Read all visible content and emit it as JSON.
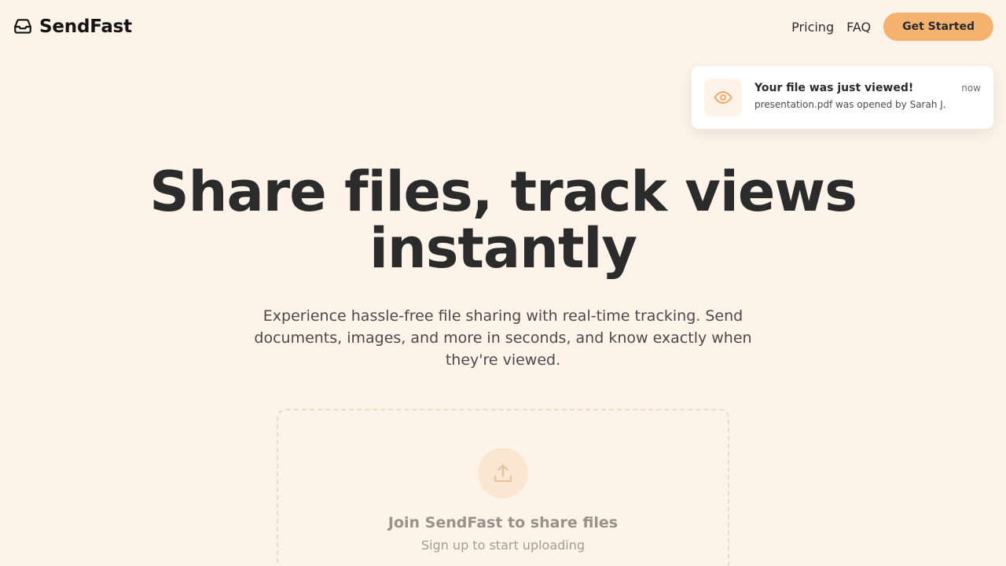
{
  "brand": {
    "name": "SendFast",
    "icon": "inbox-icon"
  },
  "nav": {
    "pricing": "Pricing",
    "faq": "FAQ",
    "cta": "Get Started"
  },
  "toast": {
    "icon": "eye-icon",
    "title": "Your file was just viewed!",
    "message": "presentation.pdf was opened by Sarah J.",
    "time": "now"
  },
  "hero": {
    "title_line1": "Share files, track views",
    "title_line2": "instantly",
    "subtitle": "Experience hassle-free file sharing with real-time tracking. Send documents, images, and more in seconds, and know exactly when they're viewed."
  },
  "upload": {
    "icon": "upload-icon",
    "title": "Join SendFast to share files",
    "subtitle": "Sign up to start uploading"
  },
  "colors": {
    "background": "#fdf3e9",
    "accent": "#f5b26f",
    "text": "#2b2b2b"
  }
}
